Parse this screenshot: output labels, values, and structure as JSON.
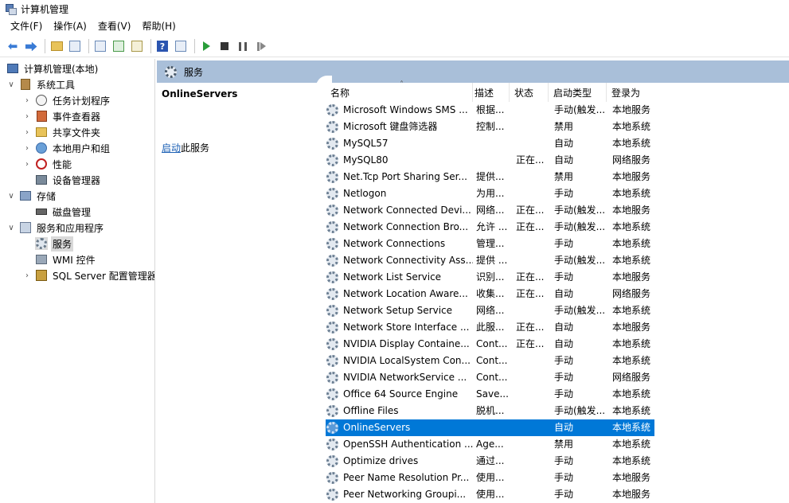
{
  "window": {
    "title": "计算机管理"
  },
  "menu": [
    "文件(F)",
    "操作(A)",
    "查看(V)",
    "帮助(H)"
  ],
  "toolbar": [
    {
      "name": "back-arrow-icon"
    },
    {
      "name": "forward-arrow-icon"
    },
    {
      "name": "up-folder-icon"
    },
    {
      "name": "show-hide-tree-icon"
    },
    {
      "name": "properties-icon"
    },
    {
      "name": "refresh-icon"
    },
    {
      "name": "export-list-icon"
    },
    {
      "name": "help-icon"
    },
    {
      "name": "show-hide-action-pane-icon"
    },
    {
      "name": "start-service-icon"
    },
    {
      "name": "stop-service-icon"
    },
    {
      "name": "pause-service-icon"
    },
    {
      "name": "resume-service-icon"
    }
  ],
  "tree": {
    "root": "计算机管理(本地)",
    "system_tools": "系统工具",
    "task_scheduler": "任务计划程序",
    "event_viewer": "事件查看器",
    "shared_folders": "共享文件夹",
    "local_users": "本地用户和组",
    "performance": "性能",
    "device_manager": "设备管理器",
    "storage": "存储",
    "disk_management": "磁盘管理",
    "services_apps": "服务和应用程序",
    "services": "服务",
    "wmi": "WMI 控件",
    "sql_config": "SQL Server 配置管理器"
  },
  "panel": {
    "header": "服务",
    "selected_service": "OnlineServers",
    "start_link": "启动",
    "start_suffix": "此服务"
  },
  "columns": {
    "name": "名称",
    "desc": "描述",
    "status": "状态",
    "startup": "启动类型",
    "logon": "登录为"
  },
  "services": [
    {
      "name": "Microsoft Windows SMS ...",
      "desc": "根据...",
      "status": "",
      "startup": "手动(触发...",
      "logon": "本地服务"
    },
    {
      "name": "Microsoft 键盘筛选器",
      "desc": "控制...",
      "status": "",
      "startup": "禁用",
      "logon": "本地系统"
    },
    {
      "name": "MySQL57",
      "desc": "",
      "status": "",
      "startup": "自动",
      "logon": "本地系统"
    },
    {
      "name": "MySQL80",
      "desc": "",
      "status": "正在...",
      "startup": "自动",
      "logon": "网络服务"
    },
    {
      "name": "Net.Tcp Port Sharing Ser...",
      "desc": "提供...",
      "status": "",
      "startup": "禁用",
      "logon": "本地服务"
    },
    {
      "name": "Netlogon",
      "desc": "为用...",
      "status": "",
      "startup": "手动",
      "logon": "本地系统"
    },
    {
      "name": "Network Connected Devi...",
      "desc": "网络...",
      "status": "正在...",
      "startup": "手动(触发...",
      "logon": "本地服务"
    },
    {
      "name": "Network Connection Bro...",
      "desc": "允许 ...",
      "status": "正在...",
      "startup": "手动(触发...",
      "logon": "本地系统"
    },
    {
      "name": "Network Connections",
      "desc": "管理...",
      "status": "",
      "startup": "手动",
      "logon": "本地系统"
    },
    {
      "name": "Network Connectivity Ass...",
      "desc": "提供 ...",
      "status": "",
      "startup": "手动(触发...",
      "logon": "本地系统"
    },
    {
      "name": "Network List Service",
      "desc": "识别...",
      "status": "正在...",
      "startup": "手动",
      "logon": "本地服务"
    },
    {
      "name": "Network Location Aware...",
      "desc": "收集...",
      "status": "正在...",
      "startup": "自动",
      "logon": "网络服务"
    },
    {
      "name": "Network Setup Service",
      "desc": "网络...",
      "status": "",
      "startup": "手动(触发...",
      "logon": "本地系统"
    },
    {
      "name": "Network Store Interface ...",
      "desc": "此服...",
      "status": "正在...",
      "startup": "自动",
      "logon": "本地服务"
    },
    {
      "name": "NVIDIA Display Containe...",
      "desc": "Cont...",
      "status": "正在...",
      "startup": "自动",
      "logon": "本地系统"
    },
    {
      "name": "NVIDIA LocalSystem Con...",
      "desc": "Cont...",
      "status": "",
      "startup": "手动",
      "logon": "本地系统"
    },
    {
      "name": "NVIDIA NetworkService ...",
      "desc": "Cont...",
      "status": "",
      "startup": "手动",
      "logon": "网络服务"
    },
    {
      "name": "Office 64 Source Engine",
      "desc": "Save...",
      "status": "",
      "startup": "手动",
      "logon": "本地系统"
    },
    {
      "name": "Offline Files",
      "desc": "脱机...",
      "status": "",
      "startup": "手动(触发...",
      "logon": "本地系统"
    },
    {
      "name": "OnlineServers",
      "desc": "",
      "status": "",
      "startup": "自动",
      "logon": "本地系统",
      "selected": true
    },
    {
      "name": "OpenSSH Authentication ...",
      "desc": "Age...",
      "status": "",
      "startup": "禁用",
      "logon": "本地系统"
    },
    {
      "name": "Optimize drives",
      "desc": "通过...",
      "status": "",
      "startup": "手动",
      "logon": "本地系统"
    },
    {
      "name": "Peer Name Resolution Pr...",
      "desc": "使用...",
      "status": "",
      "startup": "手动",
      "logon": "本地服务"
    },
    {
      "name": "Peer Networking Groupi...",
      "desc": "使用...",
      "status": "",
      "startup": "手动",
      "logon": "本地服务"
    }
  ]
}
